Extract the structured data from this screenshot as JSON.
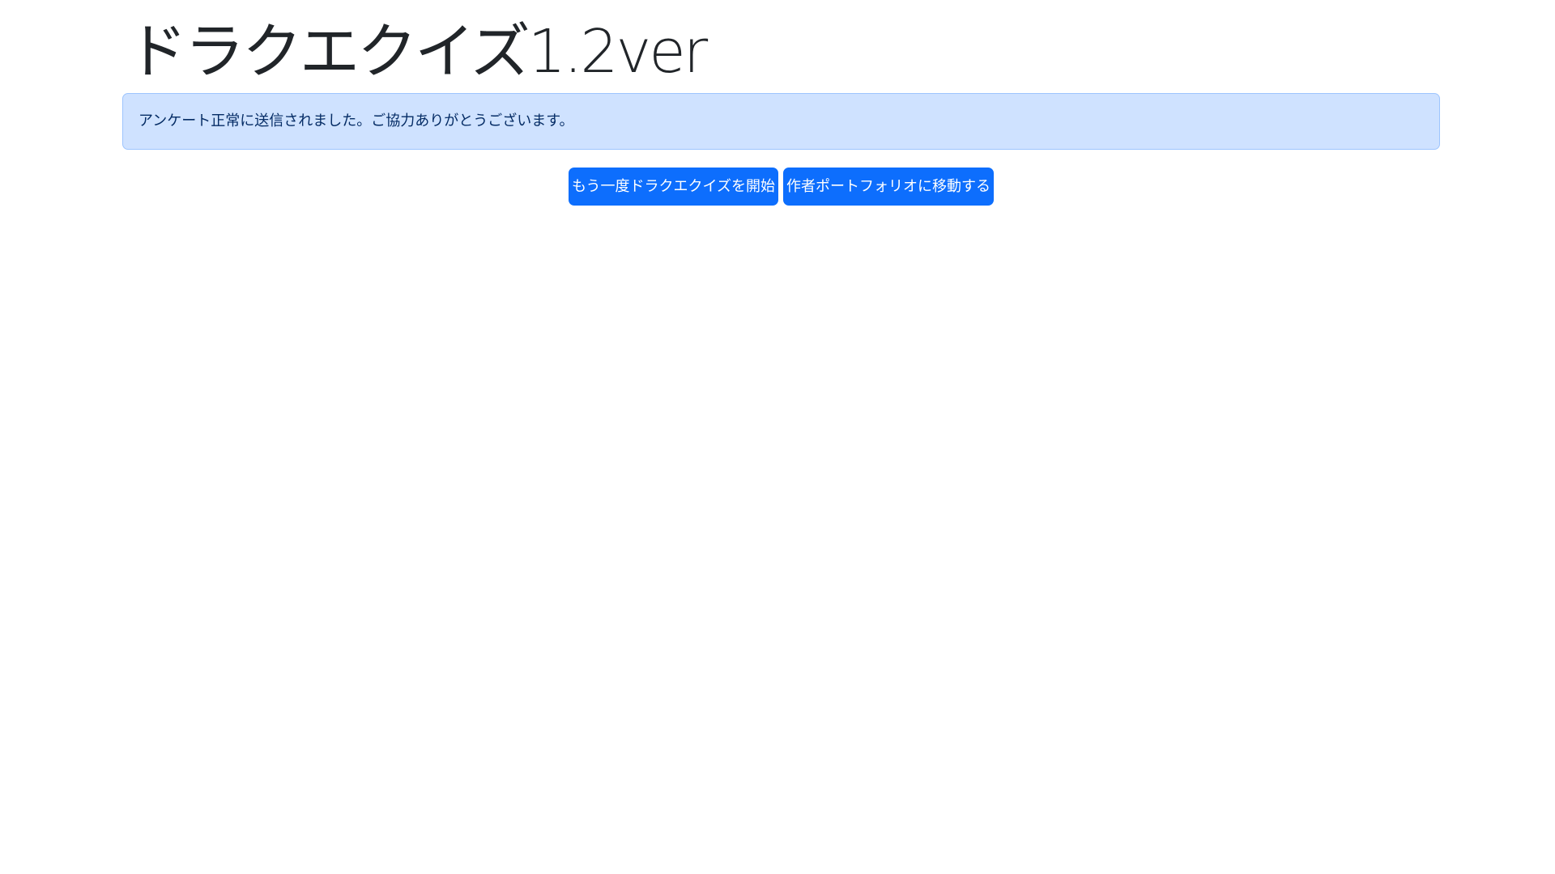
{
  "header": {
    "title": "ドラクエクイズ1.2ver"
  },
  "alert": {
    "message": "アンケート正常に送信されました。ご協力ありがとうございます。",
    "color": "#cfe2ff"
  },
  "actions": {
    "restart_label": "もう一度ドラクエクイズを開始",
    "portfolio_label": "作者ポートフォリオに移動する",
    "button_color": "#0d6efd"
  }
}
